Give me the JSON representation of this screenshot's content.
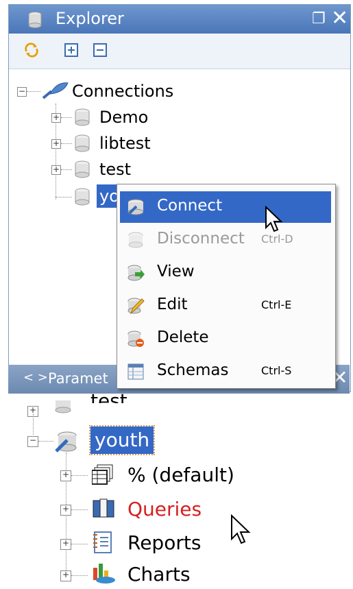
{
  "explorer": {
    "title": "Explorer",
    "toolbar": [
      "refresh-icon",
      "expand-all-icon",
      "collapse-all-icon"
    ],
    "tree": {
      "root": "Connections",
      "children": [
        "Demo",
        "libtest",
        "test",
        "youth"
      ],
      "selected_partial": "yo"
    }
  },
  "context_menu": {
    "items": [
      {
        "label": "Connect",
        "shortcut": "",
        "state": "highlighted"
      },
      {
        "label": "Disconnect",
        "shortcut": "Ctrl-D",
        "state": "disabled"
      },
      {
        "label": "View",
        "shortcut": "",
        "state": "normal"
      },
      {
        "label": "Edit",
        "shortcut": "Ctrl-E",
        "state": "normal"
      },
      {
        "label": "Delete",
        "shortcut": "",
        "state": "normal"
      },
      {
        "label": "Schemas",
        "shortcut": "Ctrl-S",
        "state": "normal"
      }
    ]
  },
  "bottom_panel": {
    "title": "Paramet"
  },
  "tree_detail": {
    "partial_top": "test",
    "connection": "youth",
    "children": [
      {
        "label": "% (default)",
        "color": "#000000"
      },
      {
        "label": "Queries",
        "color": "#d42020"
      },
      {
        "label": "Reports",
        "color": "#000000"
      },
      {
        "label": "Charts",
        "color": "#000000"
      }
    ]
  },
  "colors": {
    "selection": "#3468c6",
    "titlebar": "#5a84c2"
  }
}
